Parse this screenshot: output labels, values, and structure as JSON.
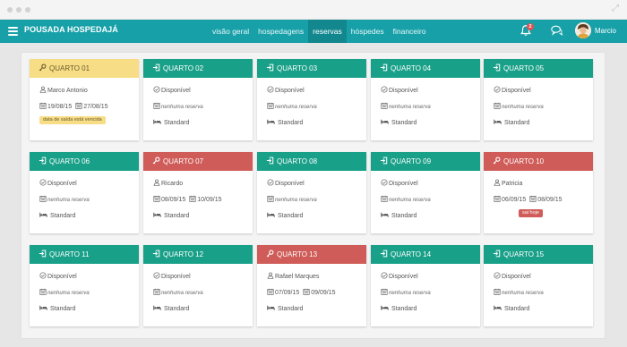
{
  "app": {
    "title": "POUSADA HOSPEDAJÁ"
  },
  "nav": {
    "tabs": [
      "visão geral",
      "hospedagens",
      "reservas",
      "hóspedes",
      "financeiro"
    ],
    "active_index": 2
  },
  "header": {
    "notification_count": "2",
    "user_name": "Marcio"
  },
  "colors": {
    "brand": "#17a0a8",
    "free": "#19a089",
    "occupied": "#cf5c58",
    "overdue": "#f7de86"
  },
  "rooms": [
    {
      "name": "QUARTO 01",
      "status": "overdue",
      "guest": "Marco Antonio",
      "checkin": "19/08/15",
      "checkout": "27/08/15",
      "note": "data de saída está vencida"
    },
    {
      "name": "QUARTO 02",
      "status": "free",
      "availability": "Disponível",
      "reservation": "nenhuma reserva",
      "type": "Standard"
    },
    {
      "name": "QUARTO 03",
      "status": "free",
      "availability": "Disponível",
      "reservation": "nenhuma reserva",
      "type": "Standard"
    },
    {
      "name": "QUARTO 04",
      "status": "free",
      "availability": "Disponível",
      "reservation": "nenhuma reserva",
      "type": "Standard"
    },
    {
      "name": "QUARTO 05",
      "status": "free",
      "availability": "Disponível",
      "reservation": "nenhuma reserva",
      "type": "Standard"
    },
    {
      "name": "QUARTO 06",
      "status": "free",
      "availability": "Disponível",
      "reservation": "nenhuma reserva",
      "type": "Standard"
    },
    {
      "name": "QUARTO 07",
      "status": "occupied",
      "guest": "Ricardo",
      "checkin": "08/09/15",
      "checkout": "10/09/15",
      "type": "Standard"
    },
    {
      "name": "QUARTO 08",
      "status": "free",
      "availability": "Disponível",
      "reservation": "nenhuma reserva",
      "type": "Standard"
    },
    {
      "name": "QUARTO 09",
      "status": "free",
      "availability": "Disponível",
      "reservation": "nenhuma reserva",
      "type": "Standard"
    },
    {
      "name": "QUARTO 10",
      "status": "occupied",
      "guest": "Patricia",
      "checkin": "06/09/15",
      "checkout": "08/09/15",
      "note": "sai hoje"
    },
    {
      "name": "QUARTO 11",
      "status": "free",
      "availability": "Disponível",
      "reservation": "nenhuma reserva",
      "type": "Standard"
    },
    {
      "name": "QUARTO 12",
      "status": "free",
      "availability": "Disponível",
      "reservation": "nenhuma reserva",
      "type": "Standard"
    },
    {
      "name": "QUARTO 13",
      "status": "occupied",
      "guest": "Rafael Marques",
      "checkin": "07/09/15",
      "checkout": "09/09/15",
      "type": "Standard"
    },
    {
      "name": "QUARTO 14",
      "status": "free",
      "availability": "Disponível",
      "reservation": "nenhuma reserva",
      "type": "Standard"
    },
    {
      "name": "QUARTO 15",
      "status": "free",
      "availability": "Disponível",
      "reservation": "nenhuma reserva",
      "type": "Standard"
    }
  ]
}
